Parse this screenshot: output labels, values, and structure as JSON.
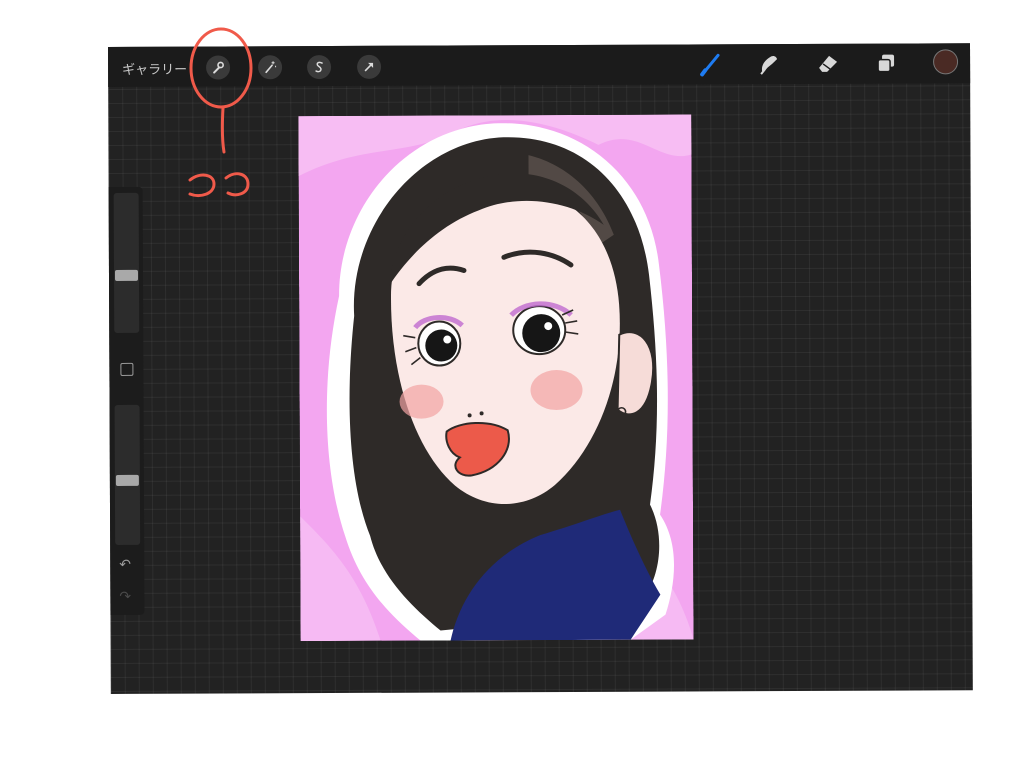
{
  "topbar": {
    "gallery_label": "ギャラリー",
    "left_tools": [
      {
        "name": "wrench-icon"
      },
      {
        "name": "magic-wand-icon"
      },
      {
        "name": "selection-s-icon"
      },
      {
        "name": "transform-arrow-icon"
      }
    ],
    "right_tools": [
      {
        "name": "brush-icon",
        "active": true
      },
      {
        "name": "smudge-icon"
      },
      {
        "name": "eraser-icon"
      },
      {
        "name": "layers-icon"
      }
    ],
    "current_color": "#4a2a24"
  },
  "sidebar": {
    "brush_size_level": 0.25,
    "opacity_level": 0.62,
    "icons": [
      "modify-square-icon",
      "undo-icon",
      "redo-icon"
    ]
  },
  "annotation": {
    "text": "ここ",
    "color": "#f05a4a"
  },
  "colors": {
    "accent_blue": "#1e7cf2",
    "background_pink": "#f3a6f0",
    "hair": "#2e2a28",
    "dress": "#1f2a78",
    "lips": "#ec5a4a"
  }
}
